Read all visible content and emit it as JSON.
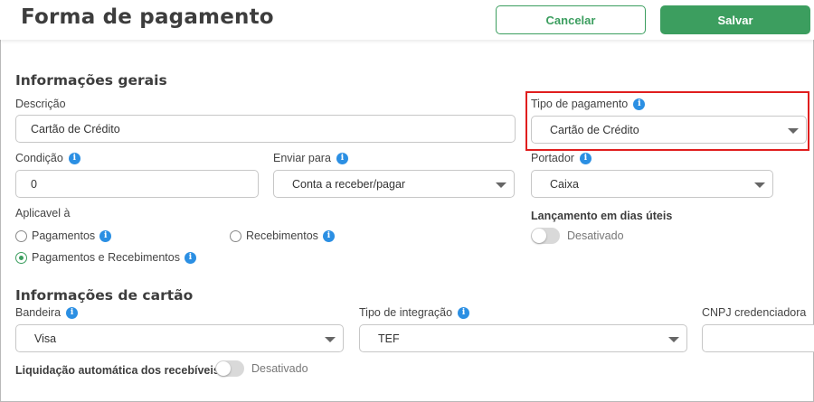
{
  "header": {
    "title": "Forma de pagamento",
    "cancel_label": "Cancelar",
    "save_label": "Salvar"
  },
  "general": {
    "section_title": "Informações gerais",
    "descricao": {
      "label": "Descrição",
      "value": "Cartão de Crédito"
    },
    "tipo_pagamento": {
      "label": "Tipo de pagamento",
      "value": "Cartão de Crédito"
    },
    "condicao": {
      "label": "Condição",
      "value": "0"
    },
    "enviar_para": {
      "label": "Enviar para",
      "value": "Conta a receber/pagar"
    },
    "portador": {
      "label": "Portador",
      "value": "Caixa"
    },
    "aplicavel": {
      "label": "Aplicavel à",
      "options": [
        {
          "label": "Pagamentos",
          "checked": false
        },
        {
          "label": "Recebimentos",
          "checked": false
        },
        {
          "label": "Pagamentos e Recebimentos",
          "checked": true
        }
      ]
    },
    "dias_uteis": {
      "label": "Lançamento em dias úteis",
      "state": "Desativado"
    }
  },
  "card": {
    "section_title": "Informações de cartão",
    "bandeira": {
      "label": "Bandeira",
      "value": "Visa"
    },
    "tipo_integracao": {
      "label": "Tipo de integração",
      "value": "TEF"
    },
    "cnpj": {
      "label": "CNPJ credenciadora",
      "value": ""
    },
    "liquidacao": {
      "label": "Liquidação automática dos recebíveis",
      "state": "Desativado"
    }
  },
  "colors": {
    "primary": "#3c9e5f",
    "info": "#2b8fe3",
    "highlight": "#e01e1e"
  }
}
